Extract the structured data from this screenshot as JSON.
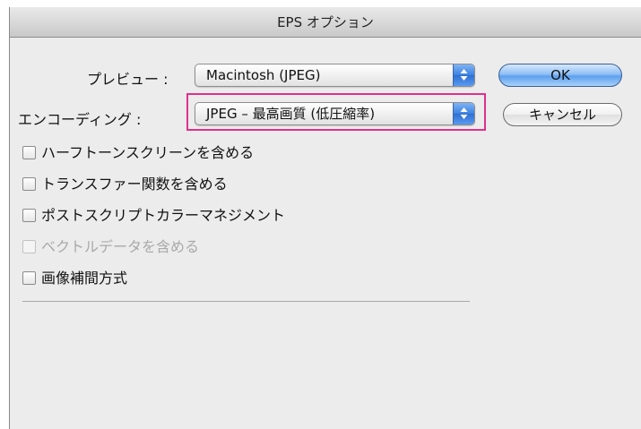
{
  "window": {
    "title": "EPS オプション"
  },
  "preview": {
    "label": "プレビュー :",
    "value": "Macintosh (JPEG)"
  },
  "encoding": {
    "label": "エンコーディング :",
    "value": "JPEG – 最高画質 (低圧縮率)"
  },
  "buttons": {
    "ok": "OK",
    "cancel": "キャンセル"
  },
  "options": [
    {
      "label": "ハーフトーンスクリーンを含める",
      "checked": false,
      "enabled": true
    },
    {
      "label": "トランスファー関数を含める",
      "checked": false,
      "enabled": true
    },
    {
      "label": "ポストスクリプトカラーマネジメント",
      "checked": false,
      "enabled": true
    },
    {
      "label": "ベクトルデータを含める",
      "checked": false,
      "enabled": false
    },
    {
      "label": "画像補間方式",
      "checked": false,
      "enabled": true
    }
  ],
  "colors": {
    "highlight": "#e0308a",
    "accent": "#3b82e0"
  }
}
